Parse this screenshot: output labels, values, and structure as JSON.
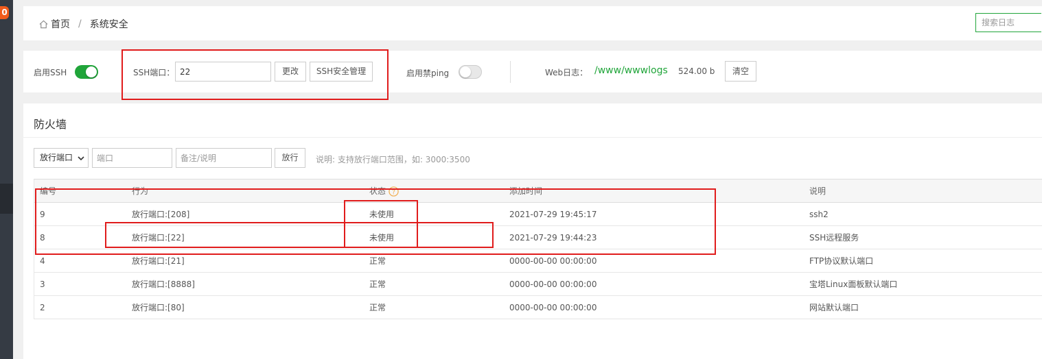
{
  "sidebar": {
    "badge": "0"
  },
  "breadcrumb": {
    "home": "首页",
    "separator": "/",
    "current": "系统安全"
  },
  "search": {
    "placeholder": "搜索日志"
  },
  "ssh": {
    "enable_label": "启用SSH",
    "enabled": true,
    "port_label": "SSH端口：",
    "port_value": "22",
    "change_button": "更改",
    "manage_button": "SSH安全管理",
    "ping_label": "启用禁ping",
    "ping_enabled": false,
    "weblog_label": "Web日志：",
    "weblog_path": "/www/wwwlogs",
    "weblog_size": "524.00 b",
    "clear_button": "清空"
  },
  "firewall": {
    "title": "防火墙",
    "select_value": "放行端口",
    "port_placeholder": "端口",
    "note_placeholder": "备注/说明",
    "allow_button": "放行",
    "hint": "说明: 支持放行端口范围，如: 3000:3500",
    "columns": [
      "编号",
      "行为",
      "状态",
      "添加时间",
      "说明"
    ],
    "rows": [
      {
        "id": "9",
        "action": "放行端口:[208]",
        "status": "未使用",
        "time": "2021-07-29 19:45:17",
        "note": "ssh2"
      },
      {
        "id": "8",
        "action": "放行端口:[22]",
        "status": "未使用",
        "time": "2021-07-29 19:44:23",
        "note": "SSH远程服务"
      },
      {
        "id": "4",
        "action": "放行端口:[21]",
        "status": "正常",
        "time": "0000-00-00 00:00:00",
        "note": "FTP协议默认端口"
      },
      {
        "id": "3",
        "action": "放行端口:[8888]",
        "status": "正常",
        "time": "0000-00-00 00:00:00",
        "note": "宝塔Linux面板默认端口"
      },
      {
        "id": "2",
        "action": "放行端口:[80]",
        "status": "正常",
        "time": "0000-00-00 00:00:00",
        "note": "网站默认端口"
      }
    ]
  },
  "colors": {
    "accent": "#20a53a",
    "annotation": "#e01b1b",
    "help_icon": "#f0ad4e"
  }
}
